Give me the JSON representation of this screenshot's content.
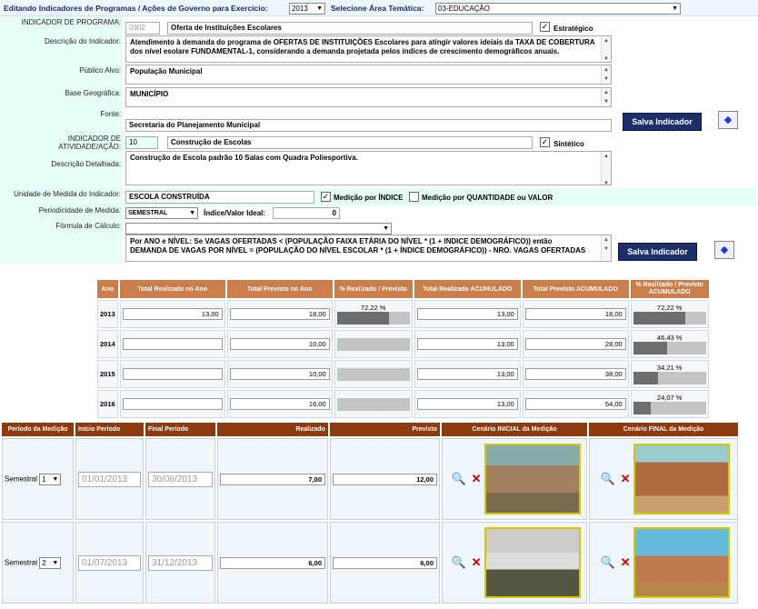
{
  "topbar": {
    "title": "Editando Indicadores de Programas / Ações de Governo para Exercício:",
    "year": "2013",
    "area_label": "Selecione Área Temática:",
    "area": "03-EDUCAÇÃO"
  },
  "form": {
    "ind_prog_label": "INDICADOR DE PROGRAMA:",
    "ind_prog_code": "0302",
    "ind_prog_name": "Oferta de Instituições Escolares",
    "estrategico_label": "Estratégico",
    "desc_label": "Descrição do Indicador:",
    "desc": "Atendimento à demanda do programa de OFERTAS DE INSTITUIÇÕES Escolares para atingir valores ideiais da TAXA DE COBERTURA dos nível esolare FUNDAMENTAL-1, considerando a demanda projetada pelos índices de crescimento demográficos anuais.",
    "publico_label": "Público Alvo:",
    "publico": "População Municipal",
    "base_label": "Base Geográfica:",
    "base": "MUNICÍPIO",
    "fonte_label": "Fonte:",
    "fonte": "Secretaria do Planejamento Municipal",
    "salva1": "Salva Indicador",
    "ind_ativ_label1": "INDICADOR DE",
    "ind_ativ_label2": "ATIVIDADE/AÇÃO:",
    "ind_ativ_code": "10",
    "ind_ativ_name": "Construção de Escolas",
    "sintetico_label": "Sintético",
    "desc_det_label": "Descrição Detalhada:",
    "desc_det": "Construção de Escola padrão 10 Salas com Quadra Poliesportiva.",
    "unidade_label": "Unidade de Medida do Indicador:",
    "unidade": "ESCOLA CONSTRUÍDA",
    "med_indice": "Medição por ÍNDICE",
    "med_qtd": "Medição por QUANTIDADE ou VALOR",
    "period_label": "Periodicidade de Medida:",
    "period": "SEMESTRAL",
    "indice_label": "Índice/Valor Ideal:",
    "indice": "0",
    "formula_label": "Fórmula de Cálculo:",
    "formula_l1": "Por ANO e NÍVEL:  Se VAGAS OFERTADAS <  (POPULAÇÃO FAIXA ETÁRIA DO NÍVEL *  (1 + INDICE DEMOGRÁFICO)) então",
    "formula_l2": "DEMANDA DE VAGAS POR NÍVEL = (POPULAÇÃO DO NÍVEL ESCOLAR * (1 + ÍNDICE DEMOGRÁFICO))  - NRO. VAGAS OFERTADAS",
    "salva2": "Salva Indicador"
  },
  "annual": {
    "headers": [
      "Ano",
      "Total Realizado no Ano",
      "Total Previsto no Ano",
      "% Realizado / Previsto",
      "Total Realizado ACUMULADO",
      "Total Previsto ACUMULADO",
      "% Realizado / Previsto ACUMULADO"
    ],
    "rows": [
      {
        "year": "2013",
        "real": "13,00",
        "prev": "18,00",
        "pct": "72,22 %",
        "pct_v": 72.22,
        "real_ac": "13,00",
        "prev_ac": "18,00",
        "pct_ac": "72,22 %",
        "pct_ac_v": 72.22
      },
      {
        "year": "2014",
        "real": "",
        "prev": "10,00",
        "pct": "",
        "pct_v": 0,
        "real_ac": "13,00",
        "prev_ac": "28,00",
        "pct_ac": "46,43 %",
        "pct_ac_v": 46.43
      },
      {
        "year": "2015",
        "real": "",
        "prev": "10,00",
        "pct": "",
        "pct_v": 0,
        "real_ac": "13,00",
        "prev_ac": "38,00",
        "pct_ac": "34,21 %",
        "pct_ac_v": 34.21
      },
      {
        "year": "2016",
        "real": "",
        "prev": "16,00",
        "pct": "",
        "pct_v": 0,
        "real_ac": "13,00",
        "prev_ac": "54,00",
        "pct_ac": "24,07 %",
        "pct_ac_v": 24.07
      }
    ]
  },
  "periods": {
    "headers": [
      "Período da Medição",
      "Início Período",
      "Final Período",
      "Realizado",
      "Previsto",
      "Cenário INICIAL da Medição",
      "Cenário FINAL da Medição"
    ],
    "rows": [
      {
        "period": "Semestral",
        "num": "1",
        "start": "01/01/2013",
        "end": "30/06/2013",
        "real": "7,00",
        "prev": "12,00"
      },
      {
        "period": "Semestral",
        "num": "2",
        "start": "01/07/2013",
        "end": "31/12/2013",
        "real": "6,00",
        "prev": "6,00"
      }
    ]
  },
  "colors": {
    "accent": "#1d2f6b",
    "header_tan": "#c97e4b",
    "header_brown": "#8b3b0f",
    "label_bg": "#e8fff8"
  }
}
